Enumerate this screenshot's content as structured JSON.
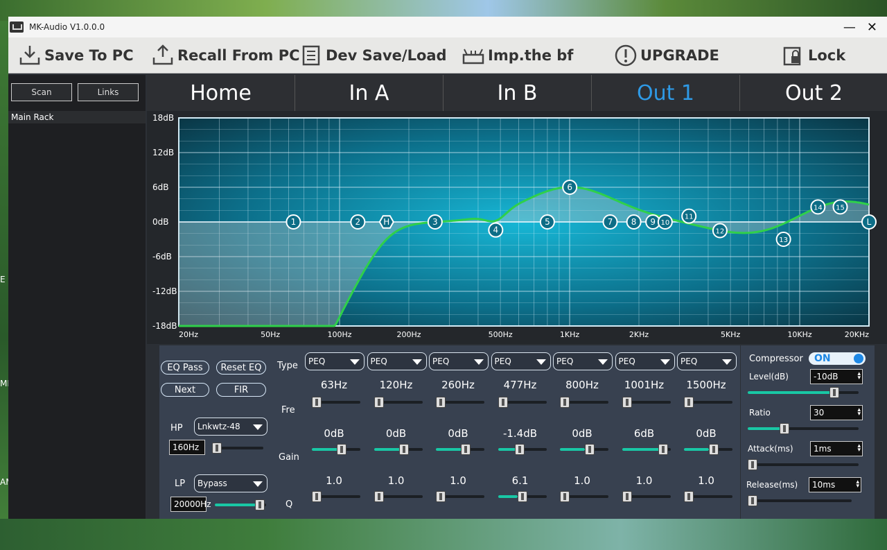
{
  "window": {
    "title": "MK-Audio  V1.0.0.0",
    "minimize": "—",
    "close": "✕"
  },
  "toolbar": {
    "save": "Save To PC",
    "recall": "Recall From PC",
    "devsave": "Dev Save/Load",
    "imp": "Imp.the bf",
    "upgrade": "UPGRADE",
    "lock": "Lock"
  },
  "side": {
    "scan": "Scan",
    "links": "Links",
    "rack": "Main Rack"
  },
  "tabs": [
    "Home",
    "In A",
    "In B",
    "Out 1",
    "Out 2"
  ],
  "active_tab": "Out 1",
  "graph": {
    "y_ticks": [
      "18dB",
      "12dB",
      "6dB",
      "0dB",
      "-6dB",
      "-12dB",
      "-18dB"
    ],
    "x_ticks": [
      "20Hz",
      "50Hz",
      "100Hz",
      "200Hz",
      "500Hz",
      "1KHz",
      "2KHz",
      "5KHz",
      "10KHz",
      "20KHz"
    ],
    "nodes": [
      {
        "label": "1",
        "freq": 63,
        "gain": 0
      },
      {
        "label": "2",
        "freq": 120,
        "gain": 0
      },
      {
        "label": "H",
        "freq": 160,
        "gain": 0
      },
      {
        "label": "3",
        "freq": 260,
        "gain": 0
      },
      {
        "label": "4",
        "freq": 477,
        "gain": -1.4
      },
      {
        "label": "5",
        "freq": 800,
        "gain": 0
      },
      {
        "label": "6",
        "freq": 1001,
        "gain": 6
      },
      {
        "label": "7",
        "freq": 1500,
        "gain": 0
      },
      {
        "label": "8",
        "freq": 1900,
        "gain": 0
      },
      {
        "label": "9",
        "freq": 2300,
        "gain": 0
      },
      {
        "label": "10",
        "freq": 2600,
        "gain": 0
      },
      {
        "label": "11",
        "freq": 3300,
        "gain": 1
      },
      {
        "label": "12",
        "freq": 4500,
        "gain": -1.5
      },
      {
        "label": "13",
        "freq": 8500,
        "gain": -3
      },
      {
        "label": "14",
        "freq": 12000,
        "gain": 2.6
      },
      {
        "label": "15",
        "freq": 15000,
        "gain": 2.6
      },
      {
        "label": "L",
        "freq": 20000,
        "gain": 0
      }
    ]
  },
  "left_controls": {
    "eq_pass": "EQ Pass",
    "reset_eq": "Reset EQ",
    "next": "Next",
    "fir": "FIR",
    "hp_label": "HP",
    "hp_type": "Lnkwtz-48",
    "hp_freq": "160Hz",
    "lp_label": "LP",
    "lp_type": "Bypass",
    "lp_freq": "20000Hz"
  },
  "row_labels": {
    "type": "Type",
    "fre": "Fre",
    "gain": "Gain",
    "q": "Q"
  },
  "bands": [
    {
      "type": "PEQ",
      "freq": "63Hz",
      "gain": "0dB",
      "q": "1.0"
    },
    {
      "type": "PEQ",
      "freq": "120Hz",
      "gain": "0dB",
      "q": "1.0"
    },
    {
      "type": "PEQ",
      "freq": "260Hz",
      "gain": "0dB",
      "q": "1.0"
    },
    {
      "type": "PEQ",
      "freq": "477Hz",
      "gain": "-1.4dB",
      "q": "6.1"
    },
    {
      "type": "PEQ",
      "freq": "800Hz",
      "gain": "0dB",
      "q": "1.0"
    },
    {
      "type": "PEQ",
      "freq": "1001Hz",
      "gain": "6dB",
      "q": "1.0"
    },
    {
      "type": "PEQ",
      "freq": "1500Hz",
      "gain": "0dB",
      "q": "1.0"
    }
  ],
  "compressor": {
    "label": "Compressor",
    "state": "ON",
    "level_label": "Level(dB)",
    "level": "-10dB",
    "ratio_label": "Ratio",
    "ratio": "30",
    "attack_label": "Attack(ms)",
    "attack": "1ms",
    "release_label": "Release(ms)",
    "release": "10ms"
  },
  "desktop": {
    "side_a": "E",
    "side_b": "ME",
    "side_c": "AME"
  }
}
